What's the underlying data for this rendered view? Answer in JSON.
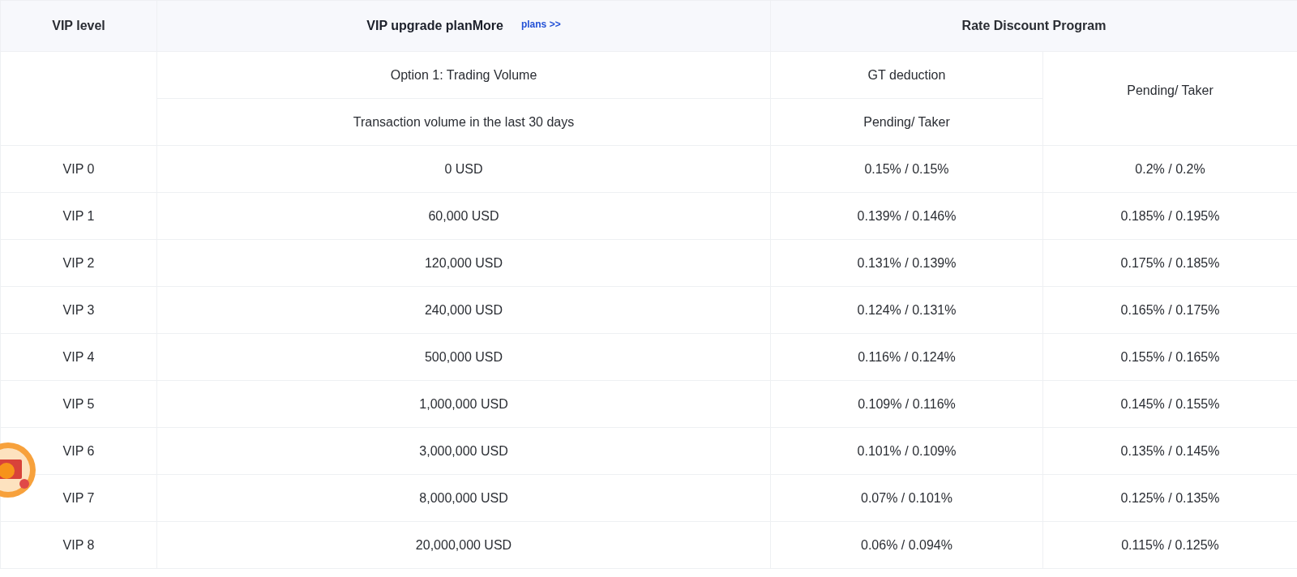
{
  "header": {
    "level_column": "VIP level",
    "plan_title": "VIP upgrade planMore",
    "plan_link": "plans >>",
    "discount_title": "Rate Discount Program"
  },
  "subheader": {
    "option": "Option 1: Trading Volume",
    "gt": "GT deduction",
    "volume": "Transaction volume in the last 30 days",
    "gt_rate": "Pending/ Taker",
    "rate": "Pending/ Taker"
  },
  "rows": [
    {
      "level": "VIP 0",
      "volume": "0 USD",
      "gt_rate": "0.15% / 0.15%",
      "rate": "0.2% / 0.2%"
    },
    {
      "level": "VIP 1",
      "volume": "60,000 USD",
      "gt_rate": "0.139% / 0.146%",
      "rate": "0.185% / 0.195%"
    },
    {
      "level": "VIP 2",
      "volume": "120,000 USD",
      "gt_rate": "0.131% / 0.139%",
      "rate": "0.175% / 0.185%"
    },
    {
      "level": "VIP 3",
      "volume": "240,000 USD",
      "gt_rate": "0.124% / 0.131%",
      "rate": "0.165% / 0.175%"
    },
    {
      "level": "VIP 4",
      "volume": "500,000 USD",
      "gt_rate": "0.116% / 0.124%",
      "rate": "0.155% / 0.165%"
    },
    {
      "level": "VIP 5",
      "volume": "1,000,000 USD",
      "gt_rate": "0.109% / 0.116%",
      "rate": "0.145% / 0.155%"
    },
    {
      "level": "VIP 6",
      "volume": "3,000,000 USD",
      "gt_rate": "0.101% / 0.109%",
      "rate": "0.135% / 0.145%"
    },
    {
      "level": "VIP 7",
      "volume": "8,000,000 USD",
      "gt_rate": "0.07% / 0.101%",
      "rate": "0.125% / 0.135%"
    },
    {
      "level": "VIP 8",
      "volume": "20,000,000 USD",
      "gt_rate": "0.06% / 0.094%",
      "rate": "0.115% / 0.125%"
    }
  ]
}
